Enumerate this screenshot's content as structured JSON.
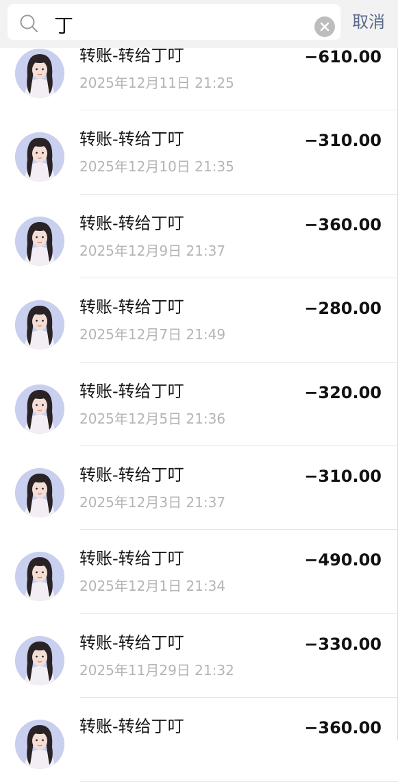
{
  "search": {
    "query": "丁",
    "cancel_label": "取消"
  },
  "transactions": [
    {
      "title": "转账-转给丁叮",
      "date": "2025年12月11日 21:25",
      "amount": "−610.00"
    },
    {
      "title": "转账-转给丁叮",
      "date": "2025年12月10日 21:35",
      "amount": "−310.00"
    },
    {
      "title": "转账-转给丁叮",
      "date": "2025年12月9日 21:37",
      "amount": "−360.00"
    },
    {
      "title": "转账-转给丁叮",
      "date": "2025年12月7日 21:49",
      "amount": "−280.00"
    },
    {
      "title": "转账-转给丁叮",
      "date": "2025年12月5日 21:36",
      "amount": "−320.00"
    },
    {
      "title": "转账-转给丁叮",
      "date": "2025年12月3日 21:37",
      "amount": "−310.00"
    },
    {
      "title": "转账-转给丁叮",
      "date": "2025年12月1日 21:34",
      "amount": "−490.00"
    },
    {
      "title": "转账-转给丁叮",
      "date": "2025年11月29日 21:32",
      "amount": "−330.00"
    },
    {
      "title": "转账-转给丁叮",
      "date": "",
      "amount": "−360.00"
    }
  ]
}
